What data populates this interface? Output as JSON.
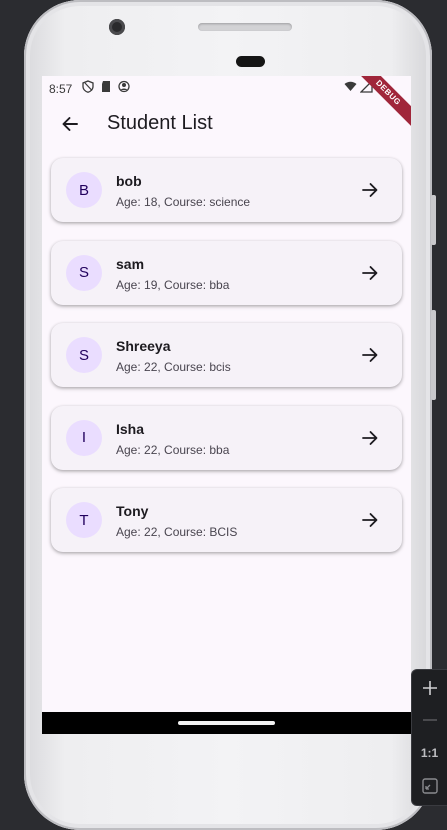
{
  "status": {
    "time": "8:57",
    "debug_label": "DEBUG"
  },
  "appbar": {
    "title": "Student List"
  },
  "students": [
    {
      "initial": "B",
      "name": "bob",
      "details": "Age: 18, Course: science"
    },
    {
      "initial": "S",
      "name": "sam",
      "details": "Age: 19, Course: bba"
    },
    {
      "initial": "S",
      "name": "Shreeya",
      "details": "Age: 22, Course: bcis"
    },
    {
      "initial": "I",
      "name": "Isha",
      "details": "Age: 22, Course: bba"
    },
    {
      "initial": "T",
      "name": "Tony",
      "details": "Age: 22, Course: BCIS"
    }
  ],
  "zoom_panel": {
    "reset_label": "1:1"
  },
  "colors": {
    "screen_bg": "#fcf7fd",
    "card_bg": "#f6f2f8",
    "avatar_bg": "#eaddff",
    "avatar_text": "#21005d",
    "debug_ribbon": "#a0263a"
  }
}
